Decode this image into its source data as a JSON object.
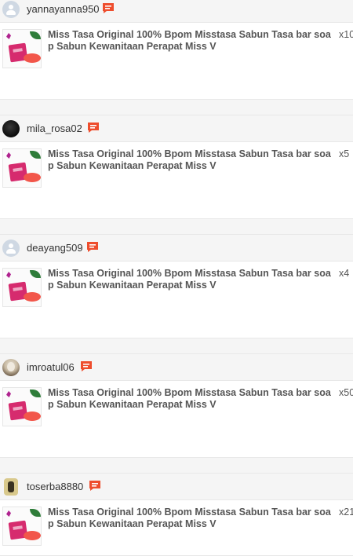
{
  "orders": [
    {
      "username": "yannayanna950",
      "avatar": "default-user-avatar",
      "product_title": "Miss Tasa Original 100% Bpom Misstasa Sabun Tasa bar soap Sabun Kewanitaan Perapat Miss V",
      "quantity": "x10"
    },
    {
      "username": "mila_rosa02",
      "avatar": "dark-photo-avatar",
      "product_title": "Miss Tasa Original 100% Bpom Misstasa Sabun Tasa bar soap Sabun Kewanitaan Perapat Miss V",
      "quantity": "x5"
    },
    {
      "username": "deayang509",
      "avatar": "default-user-avatar",
      "product_title": "Miss Tasa Original 100% Bpom Misstasa Sabun Tasa bar soap Sabun Kewanitaan Perapat Miss V",
      "quantity": "x4"
    },
    {
      "username": "imroatul06",
      "avatar": "portrait-photo-avatar",
      "product_title": "Miss Tasa Original 100% Bpom Misstasa Sabun Tasa bar soap Sabun Kewanitaan Perapat Miss V",
      "quantity": "x50"
    },
    {
      "username": "toserba8880",
      "avatar": "shop-logo-avatar",
      "product_title": "Miss Tasa Original 100% Bpom Misstasa Sabun Tasa bar soap Sabun Kewanitaan Perapat Miss V",
      "quantity": "x21"
    }
  ],
  "icons": {
    "chat": "chat-icon"
  },
  "colors": {
    "chat_icon": "#ee4d2d",
    "text": "#555555",
    "header_bg": "#f5f5f5"
  }
}
